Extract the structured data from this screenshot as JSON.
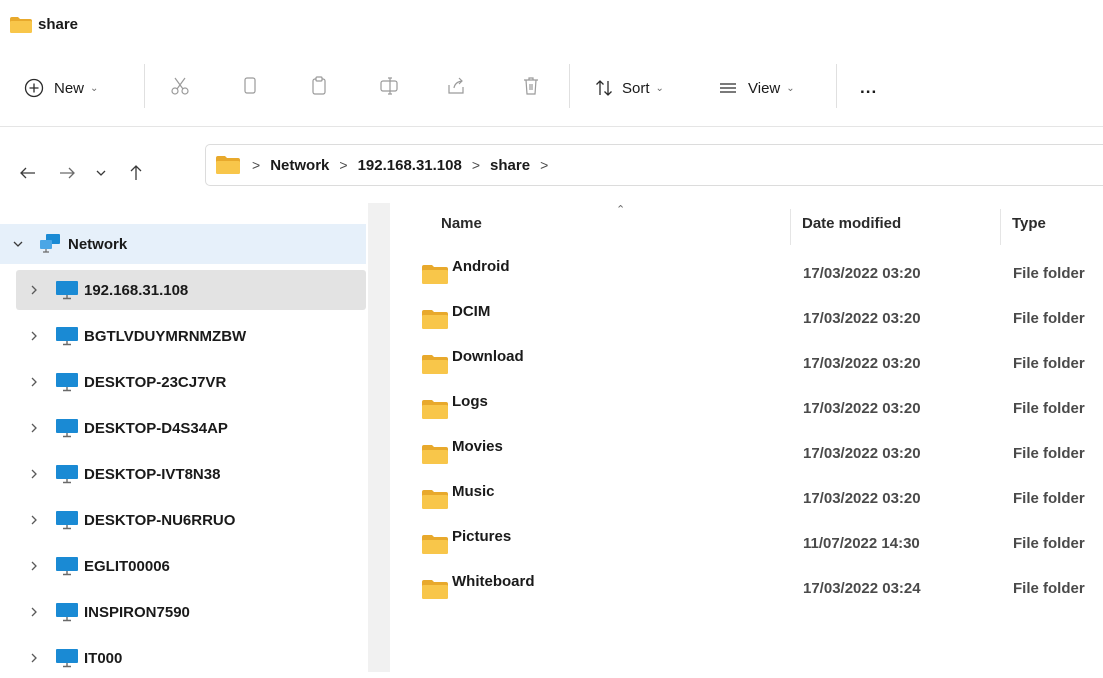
{
  "window": {
    "title": "share"
  },
  "toolbar": {
    "new_label": "New",
    "sort_label": "Sort",
    "view_label": "View",
    "more_label": "..."
  },
  "address": {
    "crumbs": [
      "Network",
      "192.168.31.108",
      "share"
    ]
  },
  "sidebar": {
    "root": "Network",
    "items": [
      "192.168.31.108",
      "BGTLVDUYMRNMZBW",
      "DESKTOP-23CJ7VR",
      "DESKTOP-D4S34AP",
      "DESKTOP-IVT8N38",
      "DESKTOP-NU6RRUO",
      "EGLIT00006",
      "INSPIRON7590",
      "IT000"
    ]
  },
  "columns": {
    "name": "Name",
    "date": "Date modified",
    "type": "Type"
  },
  "files": [
    {
      "name": "Android",
      "date": "17/03/2022 03:20",
      "type": "File folder"
    },
    {
      "name": "DCIM",
      "date": "17/03/2022 03:20",
      "type": "File folder"
    },
    {
      "name": "Download",
      "date": "17/03/2022 03:20",
      "type": "File folder"
    },
    {
      "name": "Logs",
      "date": "17/03/2022 03:20",
      "type": "File folder"
    },
    {
      "name": "Movies",
      "date": "17/03/2022 03:20",
      "type": "File folder"
    },
    {
      "name": "Music",
      "date": "17/03/2022 03:20",
      "type": "File folder"
    },
    {
      "name": "Pictures",
      "date": "11/07/2022 14:30",
      "type": "File folder"
    },
    {
      "name": "Whiteboard",
      "date": "17/03/2022 03:24",
      "type": "File folder"
    }
  ],
  "colors": {
    "folder": "#f8c64a",
    "folder_dark": "#e8a92c",
    "pc": "#1a8ad4",
    "selected": "#e6f0fa",
    "hover": "#e3e3e3"
  }
}
